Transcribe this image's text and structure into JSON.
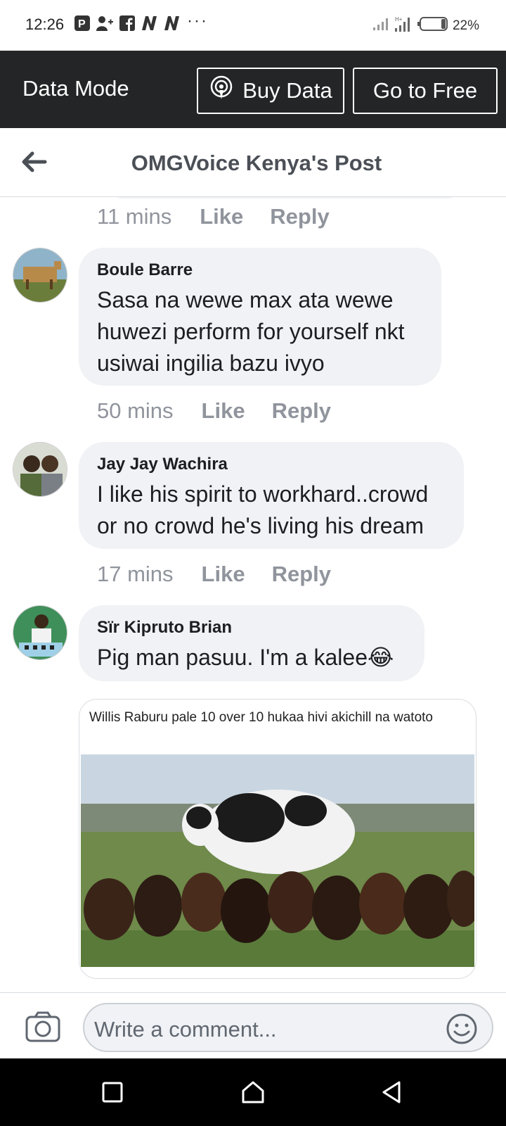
{
  "status_bar": {
    "time": "12:26",
    "battery": "22%"
  },
  "data_bar": {
    "mode_label": "Data Mode",
    "buy_data": "Buy Data",
    "go_free": "Go to Free"
  },
  "header": {
    "title": "OMGVoice Kenya's Post"
  },
  "meta_labels": {
    "like": "Like",
    "reply": "Reply"
  },
  "comments": [
    {
      "time": "11 mins"
    },
    {
      "author": "Boule Barre",
      "lines": [
        "Sasa na wewe max ata wewe",
        "huwezi perform for yourself nkt",
        "usiwai ingilia bazu ivyo"
      ],
      "time": "50 mins"
    },
    {
      "author": "Jay Jay Wachira",
      "lines": [
        "I like his spirit to workhard..crowd",
        "or no crowd he's living his dream"
      ],
      "time": "17 mins"
    },
    {
      "author": "Sïr Kipruto Brian",
      "lines": [
        "Pig man pasuu. I'm a kalee😂"
      ],
      "attachment_caption": "Willis Raburu pale 10 over 10 hukaa hivi akichill na watoto"
    }
  ],
  "composer": {
    "placeholder": "Write a comment..."
  },
  "icons": {
    "status_left": [
      "p-icon",
      "person-add-icon",
      "facebook-icon",
      "n-icon",
      "n-icon"
    ],
    "status_right": [
      "signal-icon",
      "signal-hplus-icon",
      "battery-icon"
    ],
    "buy_data": "broadcast-icon",
    "header_back": "back-arrow-icon",
    "composer_left": "camera-icon",
    "composer_right": "emoji-icon",
    "nav": [
      "recents-square-icon",
      "home-icon",
      "back-triangle-icon"
    ]
  },
  "colors": {
    "data_bar_bg": "#242526",
    "bubble_bg": "#f0f2f5",
    "meta_text": "#90949c"
  }
}
